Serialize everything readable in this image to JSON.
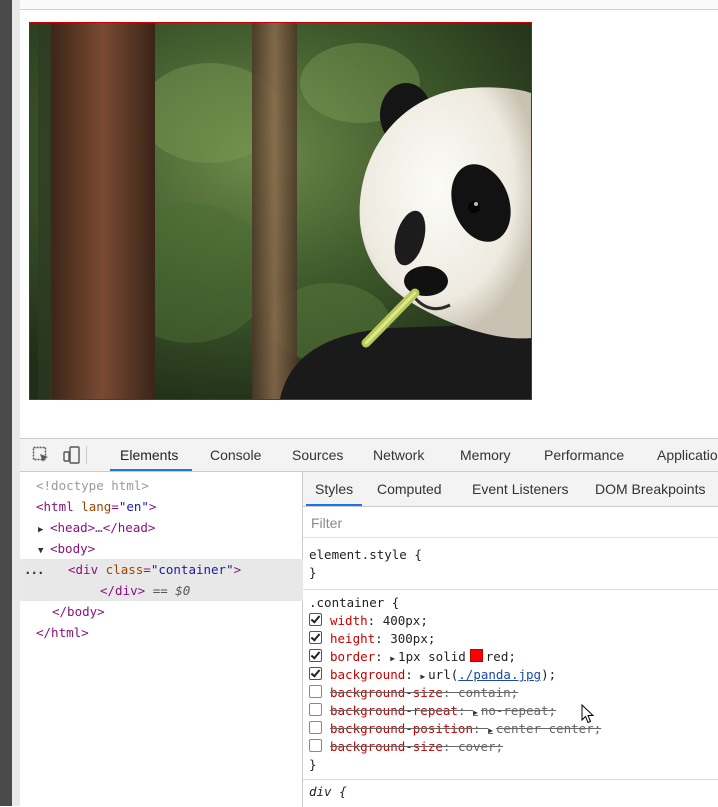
{
  "page": {
    "container_border_color": "#d40000",
    "image_subject": "panda"
  },
  "devtools": {
    "toolbar_icons": [
      "inspect-element-icon",
      "device-toolbar-icon"
    ],
    "main_tabs": [
      "Elements",
      "Console",
      "Sources",
      "Network",
      "Memory",
      "Performance",
      "Applicatio"
    ],
    "active_main_tab": "Elements",
    "dom": {
      "doctype": "<!doctype html>",
      "html_open": "html",
      "html_lang_attr": "lang",
      "html_lang_val": "\"en\"",
      "head": "head",
      "head_ellipsis": "…",
      "body": "body",
      "div": "div",
      "div_class_attr": "class",
      "div_class_val": "\"container\"",
      "div_close": "</div>",
      "eq_zero": "== $0",
      "body_close": "</body>",
      "html_close": "</html>",
      "ellipsis_marker": "..."
    },
    "styles_tabs": [
      "Styles",
      "Computed",
      "Event Listeners",
      "DOM Breakpoints"
    ],
    "active_styles_tab": "Styles",
    "filter_placeholder": "Filter",
    "element_style": {
      "selector": "element.style {",
      "close": "}"
    },
    "container_rule": {
      "selector": ".container {",
      "props": [
        {
          "checked": true,
          "name": "width",
          "value": "400px;",
          "struck": false
        },
        {
          "checked": true,
          "name": "height",
          "value": "300px;",
          "struck": false
        },
        {
          "checked": true,
          "name": "border",
          "value_pre": "1px solid",
          "value_post": "red;",
          "struck": false
        },
        {
          "checked": true,
          "name": "background",
          "value_pre": "url(",
          "link": "./panda.jpg",
          "value_post": ");",
          "struck": false
        },
        {
          "checked": false,
          "name": "background-size",
          "value": "contain;",
          "struck": true
        },
        {
          "checked": false,
          "name": "background-repeat",
          "value": "no-repeat;",
          "struck": true
        },
        {
          "checked": false,
          "name": "background-position",
          "value": "center center;",
          "struck": true
        },
        {
          "checked": false,
          "name": "background-size",
          "value": "cover;",
          "struck": true
        }
      ],
      "close": "}"
    },
    "div_rule": {
      "selector": "div {"
    },
    "swatch_color": "#ff0000"
  }
}
